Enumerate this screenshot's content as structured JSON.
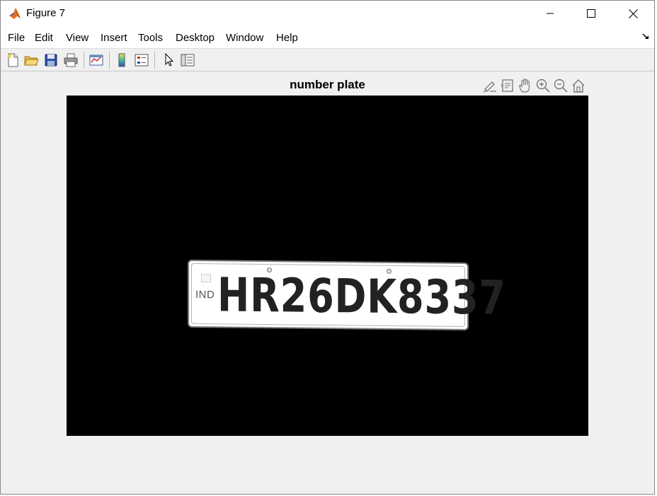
{
  "window": {
    "title": "Figure 7"
  },
  "menu": {
    "items": [
      "File",
      "Edit",
      "View",
      "Insert",
      "Tools",
      "Desktop",
      "Window",
      "Help"
    ]
  },
  "toolbar": {
    "icons": [
      "new-figure-icon",
      "open-file-icon",
      "save-icon",
      "print-icon",
      "link-plot-icon",
      "insert-colorbar-icon",
      "insert-legend-icon",
      "edit-plot-arrow-icon",
      "property-inspector-icon"
    ]
  },
  "axes": {
    "title": "number plate",
    "tools": [
      "brush-data-icon",
      "data-tips-icon",
      "pan-icon",
      "zoom-in-icon",
      "zoom-out-icon",
      "restore-view-icon"
    ]
  },
  "plate": {
    "country_code": "IND",
    "number": "HR26DK8337"
  },
  "colors": {
    "image_background": "#000000",
    "plate": "#ffffff",
    "figure_background": "#f0f0f0"
  }
}
